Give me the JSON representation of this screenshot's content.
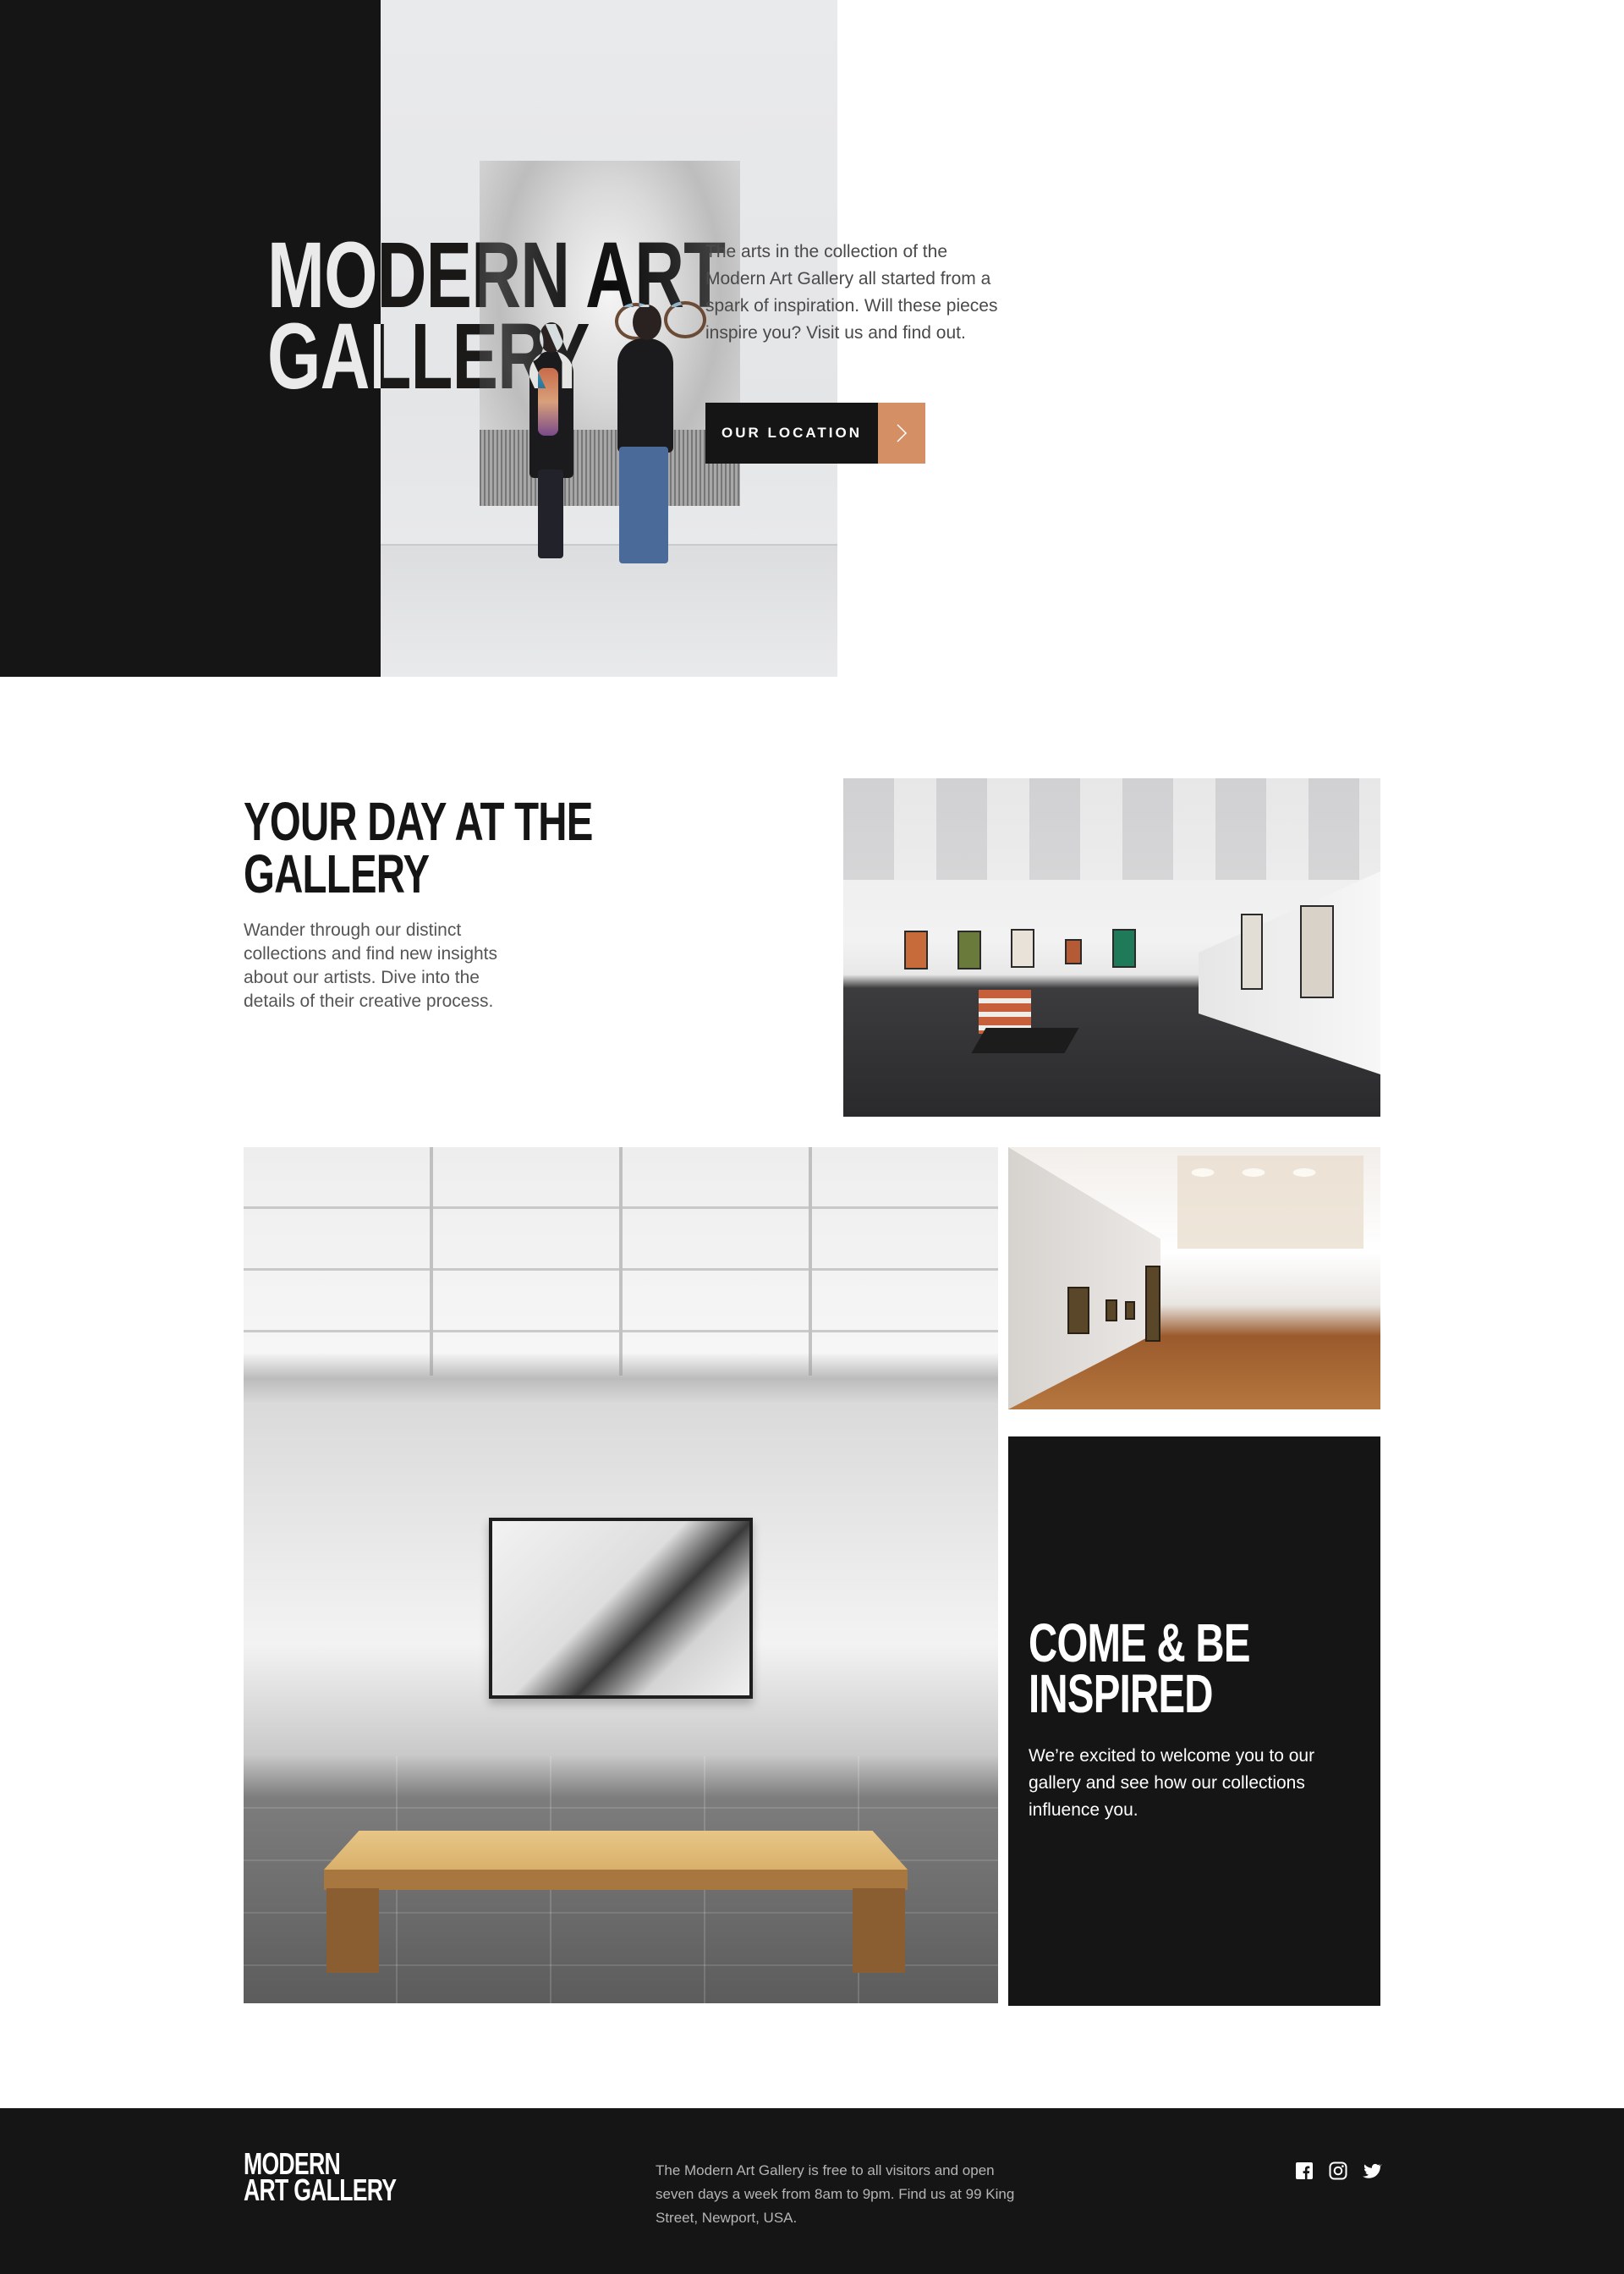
{
  "hero": {
    "title_line1": "Modern Art",
    "title_line2": "Gallery",
    "intro": "The arts in the collection of the Modern Art Gallery all started from a spark of inspiration. Will these pieces inspire you? Visit us and find out.",
    "cta_label": "Our Location",
    "cta_icon": "chevron-right-icon"
  },
  "day": {
    "title_line1": "Your day at the",
    "title_line2": "gallery",
    "text": "Wander through our distinct collections and find new insights about our artists. Dive into the details of their creative process."
  },
  "inspire": {
    "title_line1": "Come & be",
    "title_line2": "inspired",
    "text": "We’re excited to welcome you to our gallery and see how our collections influence you."
  },
  "footer": {
    "logo_line1": "Modern",
    "logo_line2": "Art Gallery",
    "info": "The Modern Art Gallery is free to all visitors and open seven days a week from 8am to 9pm. Find us at 99 King Street, Newport, USA.",
    "socials": [
      "facebook-icon",
      "instagram-icon",
      "twitter-icon"
    ]
  },
  "colors": {
    "dark": "#151515",
    "accent": "#d58f65",
    "white": "#ffffff",
    "muted": "#b5b5b5"
  }
}
